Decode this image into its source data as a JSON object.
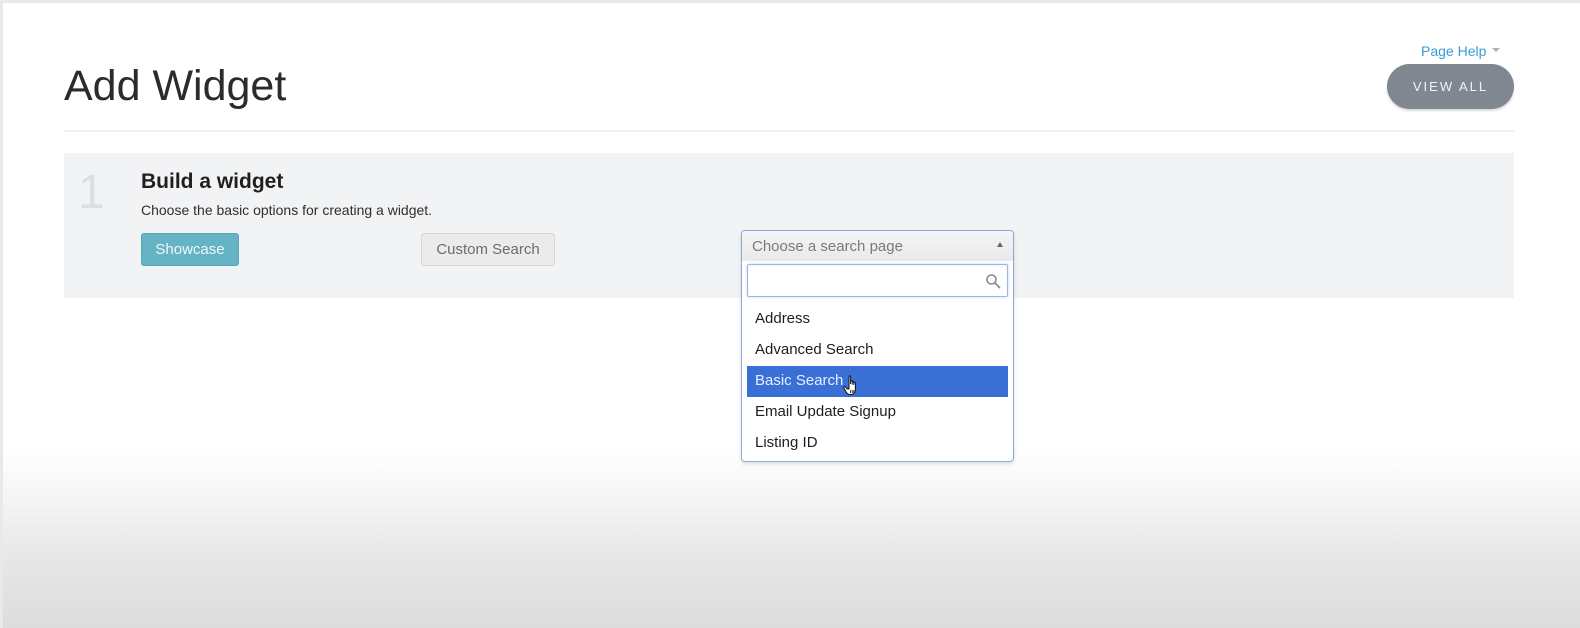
{
  "header": {
    "title": "Add Widget",
    "page_help_label": "Page Help",
    "view_all_label": "VIEW ALL"
  },
  "step": {
    "number": "1",
    "title": "Build a widget",
    "description": "Choose the basic options for creating a widget."
  },
  "buttons": {
    "showcase_label": "Showcase",
    "custom_search_label": "Custom Search"
  },
  "search_page_select": {
    "placeholder": "Choose a search page",
    "search_value": "",
    "search_placeholder": "",
    "options": [
      {
        "label": "Address",
        "highlighted": false
      },
      {
        "label": "Advanced Search",
        "highlighted": false
      },
      {
        "label": "Basic Search",
        "highlighted": true
      },
      {
        "label": "Email Update Signup",
        "highlighted": false
      },
      {
        "label": "Listing ID",
        "highlighted": false
      }
    ]
  },
  "colors": {
    "link": "#3a9ad9",
    "showcase_button": "#66b3c6",
    "view_all_button": "#808790",
    "highlight": "#3a6fd6"
  }
}
